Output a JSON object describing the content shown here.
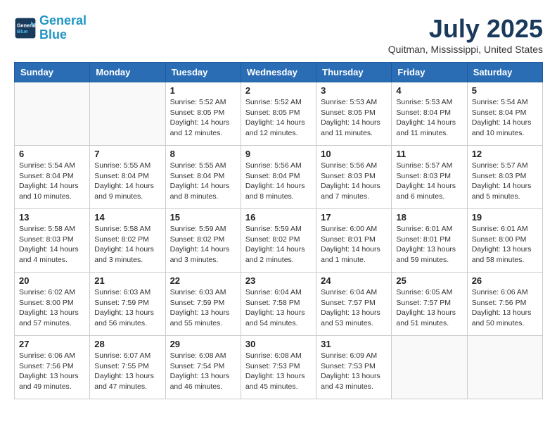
{
  "header": {
    "logo_line1": "General",
    "logo_line2": "Blue",
    "month": "July 2025",
    "location": "Quitman, Mississippi, United States"
  },
  "weekdays": [
    "Sunday",
    "Monday",
    "Tuesday",
    "Wednesday",
    "Thursday",
    "Friday",
    "Saturday"
  ],
  "weeks": [
    [
      {
        "day": "",
        "empty": true
      },
      {
        "day": "",
        "empty": true
      },
      {
        "day": "1",
        "sunrise": "5:52 AM",
        "sunset": "8:05 PM",
        "daylight": "14 hours and 12 minutes."
      },
      {
        "day": "2",
        "sunrise": "5:52 AM",
        "sunset": "8:05 PM",
        "daylight": "14 hours and 12 minutes."
      },
      {
        "day": "3",
        "sunrise": "5:53 AM",
        "sunset": "8:05 PM",
        "daylight": "14 hours and 11 minutes."
      },
      {
        "day": "4",
        "sunrise": "5:53 AM",
        "sunset": "8:04 PM",
        "daylight": "14 hours and 11 minutes."
      },
      {
        "day": "5",
        "sunrise": "5:54 AM",
        "sunset": "8:04 PM",
        "daylight": "14 hours and 10 minutes."
      }
    ],
    [
      {
        "day": "6",
        "sunrise": "5:54 AM",
        "sunset": "8:04 PM",
        "daylight": "14 hours and 10 minutes."
      },
      {
        "day": "7",
        "sunrise": "5:55 AM",
        "sunset": "8:04 PM",
        "daylight": "14 hours and 9 minutes."
      },
      {
        "day": "8",
        "sunrise": "5:55 AM",
        "sunset": "8:04 PM",
        "daylight": "14 hours and 8 minutes."
      },
      {
        "day": "9",
        "sunrise": "5:56 AM",
        "sunset": "8:04 PM",
        "daylight": "14 hours and 8 minutes."
      },
      {
        "day": "10",
        "sunrise": "5:56 AM",
        "sunset": "8:03 PM",
        "daylight": "14 hours and 7 minutes."
      },
      {
        "day": "11",
        "sunrise": "5:57 AM",
        "sunset": "8:03 PM",
        "daylight": "14 hours and 6 minutes."
      },
      {
        "day": "12",
        "sunrise": "5:57 AM",
        "sunset": "8:03 PM",
        "daylight": "14 hours and 5 minutes."
      }
    ],
    [
      {
        "day": "13",
        "sunrise": "5:58 AM",
        "sunset": "8:03 PM",
        "daylight": "14 hours and 4 minutes."
      },
      {
        "day": "14",
        "sunrise": "5:58 AM",
        "sunset": "8:02 PM",
        "daylight": "14 hours and 3 minutes."
      },
      {
        "day": "15",
        "sunrise": "5:59 AM",
        "sunset": "8:02 PM",
        "daylight": "14 hours and 3 minutes."
      },
      {
        "day": "16",
        "sunrise": "5:59 AM",
        "sunset": "8:02 PM",
        "daylight": "14 hours and 2 minutes."
      },
      {
        "day": "17",
        "sunrise": "6:00 AM",
        "sunset": "8:01 PM",
        "daylight": "14 hours and 1 minute."
      },
      {
        "day": "18",
        "sunrise": "6:01 AM",
        "sunset": "8:01 PM",
        "daylight": "13 hours and 59 minutes."
      },
      {
        "day": "19",
        "sunrise": "6:01 AM",
        "sunset": "8:00 PM",
        "daylight": "13 hours and 58 minutes."
      }
    ],
    [
      {
        "day": "20",
        "sunrise": "6:02 AM",
        "sunset": "8:00 PM",
        "daylight": "13 hours and 57 minutes."
      },
      {
        "day": "21",
        "sunrise": "6:03 AM",
        "sunset": "7:59 PM",
        "daylight": "13 hours and 56 minutes."
      },
      {
        "day": "22",
        "sunrise": "6:03 AM",
        "sunset": "7:59 PM",
        "daylight": "13 hours and 55 minutes."
      },
      {
        "day": "23",
        "sunrise": "6:04 AM",
        "sunset": "7:58 PM",
        "daylight": "13 hours and 54 minutes."
      },
      {
        "day": "24",
        "sunrise": "6:04 AM",
        "sunset": "7:57 PM",
        "daylight": "13 hours and 53 minutes."
      },
      {
        "day": "25",
        "sunrise": "6:05 AM",
        "sunset": "7:57 PM",
        "daylight": "13 hours and 51 minutes."
      },
      {
        "day": "26",
        "sunrise": "6:06 AM",
        "sunset": "7:56 PM",
        "daylight": "13 hours and 50 minutes."
      }
    ],
    [
      {
        "day": "27",
        "sunrise": "6:06 AM",
        "sunset": "7:56 PM",
        "daylight": "13 hours and 49 minutes."
      },
      {
        "day": "28",
        "sunrise": "6:07 AM",
        "sunset": "7:55 PM",
        "daylight": "13 hours and 47 minutes."
      },
      {
        "day": "29",
        "sunrise": "6:08 AM",
        "sunset": "7:54 PM",
        "daylight": "13 hours and 46 minutes."
      },
      {
        "day": "30",
        "sunrise": "6:08 AM",
        "sunset": "7:53 PM",
        "daylight": "13 hours and 45 minutes."
      },
      {
        "day": "31",
        "sunrise": "6:09 AM",
        "sunset": "7:53 PM",
        "daylight": "13 hours and 43 minutes."
      },
      {
        "day": "",
        "empty": true
      },
      {
        "day": "",
        "empty": true
      }
    ]
  ]
}
